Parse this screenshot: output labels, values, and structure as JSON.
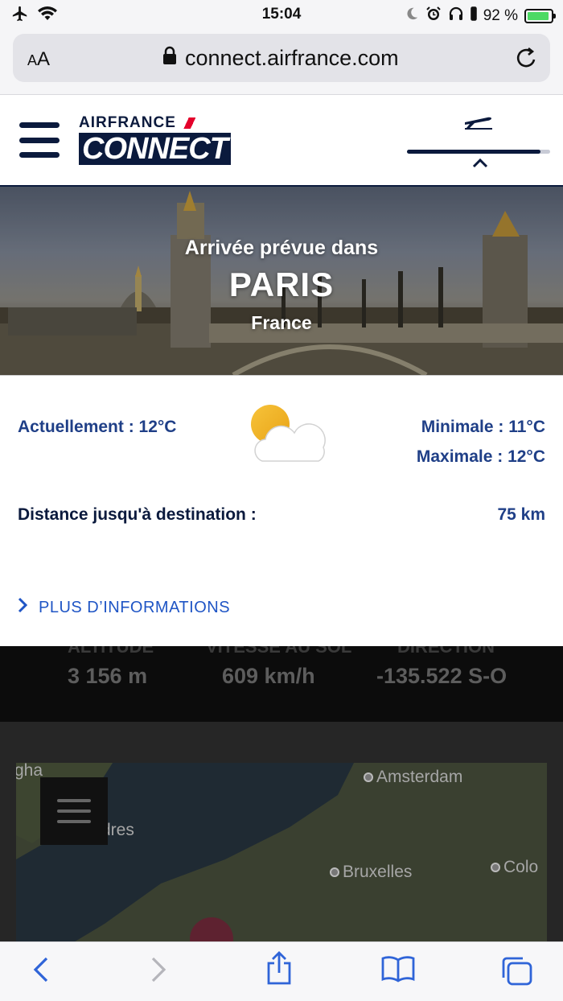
{
  "status_bar": {
    "time": "15:04",
    "battery_percent": "92 %",
    "battery_level": 0.92,
    "icons": [
      "airplane-mode-icon",
      "wifi-icon",
      "moon-icon",
      "alarm-icon",
      "headphones-icon",
      "battery-icon"
    ]
  },
  "browser": {
    "text_size_label": "AA",
    "url": "connect.airfrance.com"
  },
  "header": {
    "brand_top": "AIRFRANCE",
    "brand_bottom": "CONNECT",
    "flight_progress": 0.93
  },
  "hero": {
    "arrival_text": "Arrivée prévue dans",
    "city": "PARIS",
    "country": "France"
  },
  "weather": {
    "current": "Actuellement : 12°C",
    "min": "Minimale : 11°C",
    "max": "Maximale : 12°C",
    "icon": "partly-cloudy-icon"
  },
  "distance": {
    "label": "Distance jusqu'à destination :",
    "value": "75 km"
  },
  "more_info": {
    "label": "PLUS D’INFORMATIONS"
  },
  "flight_stats": {
    "labels": [
      "ALTITUDE",
      "VITESSE AU SOL",
      "DIRECTION"
    ],
    "altitude": "3 156 m",
    "speed": "609 km/h",
    "direction": "-135.522 S-O"
  },
  "map": {
    "cities": {
      "amsterdam": "Amsterdam",
      "londres": "dres",
      "bruxelles": "Bruxelles",
      "cologne": "Colo",
      "partial": "gha"
    }
  },
  "colors": {
    "navy": "#0b1a3d",
    "accent_blue": "#1f3f87",
    "link_blue": "#1f55c5",
    "af_red": "#e4002b"
  }
}
